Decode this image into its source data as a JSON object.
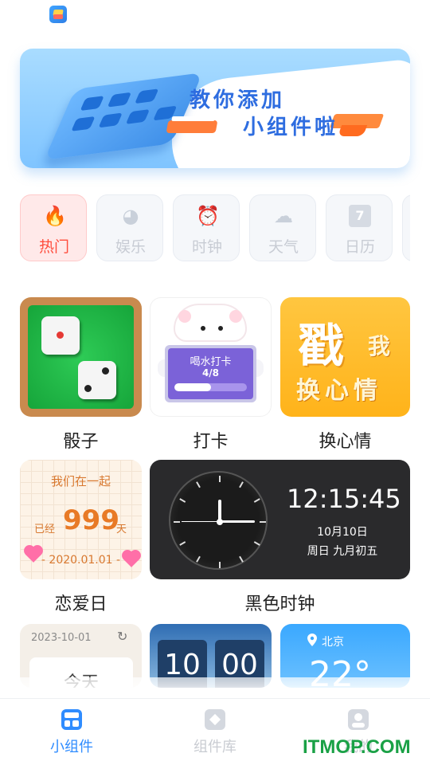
{
  "banner": {
    "line1": "教你添加",
    "line2": "小组件啦"
  },
  "categories": [
    {
      "label": "热门",
      "icon": "fire-icon",
      "glyph": "🔥",
      "active": true
    },
    {
      "label": "娱乐",
      "icon": "game-icon",
      "glyph": "◕",
      "active": false
    },
    {
      "label": "时钟",
      "icon": "alarm-clock-icon",
      "glyph": "⏰",
      "active": false
    },
    {
      "label": "天气",
      "icon": "cloud-icon",
      "glyph": "☁",
      "active": false
    },
    {
      "label": "日历",
      "icon": "calendar-icon",
      "glyph": "7",
      "active": false
    }
  ],
  "widgets": {
    "dice": {
      "label": "骰子"
    },
    "checkin": {
      "label": "打卡",
      "title": "喝水打卡",
      "progress_text": "4/8",
      "progress": 0.5
    },
    "mood": {
      "label": "换心情",
      "big": "戳",
      "small1": "我",
      "small2": "换心情"
    },
    "love": {
      "label": "恋爱日",
      "top": "我们在一起",
      "prefix": "已经",
      "days": "999",
      "suffix": "天",
      "date": "- 2020.01.01 -"
    },
    "clock": {
      "label": "黑色时钟",
      "time": "12:15:45",
      "date": "10月10日",
      "lunar": "周日 九月初五"
    },
    "note": {
      "date": "2023-10-01",
      "text": "今天"
    },
    "flip": {
      "hour": "10",
      "minute": "00"
    },
    "weather": {
      "city": "北京",
      "temp": "22°"
    }
  },
  "nav": [
    {
      "label": "小组件",
      "icon": "widget-grid-icon",
      "active": true
    },
    {
      "label": "组件库",
      "icon": "widget-library-icon",
      "active": false
    },
    {
      "label": "我的",
      "icon": "profile-icon",
      "active": false
    }
  ],
  "watermark": "ITMOP.COM",
  "colors": {
    "accent": "#2f8cff",
    "hot": "#ff4d3d",
    "clock_bg": "#2a2a2c"
  }
}
